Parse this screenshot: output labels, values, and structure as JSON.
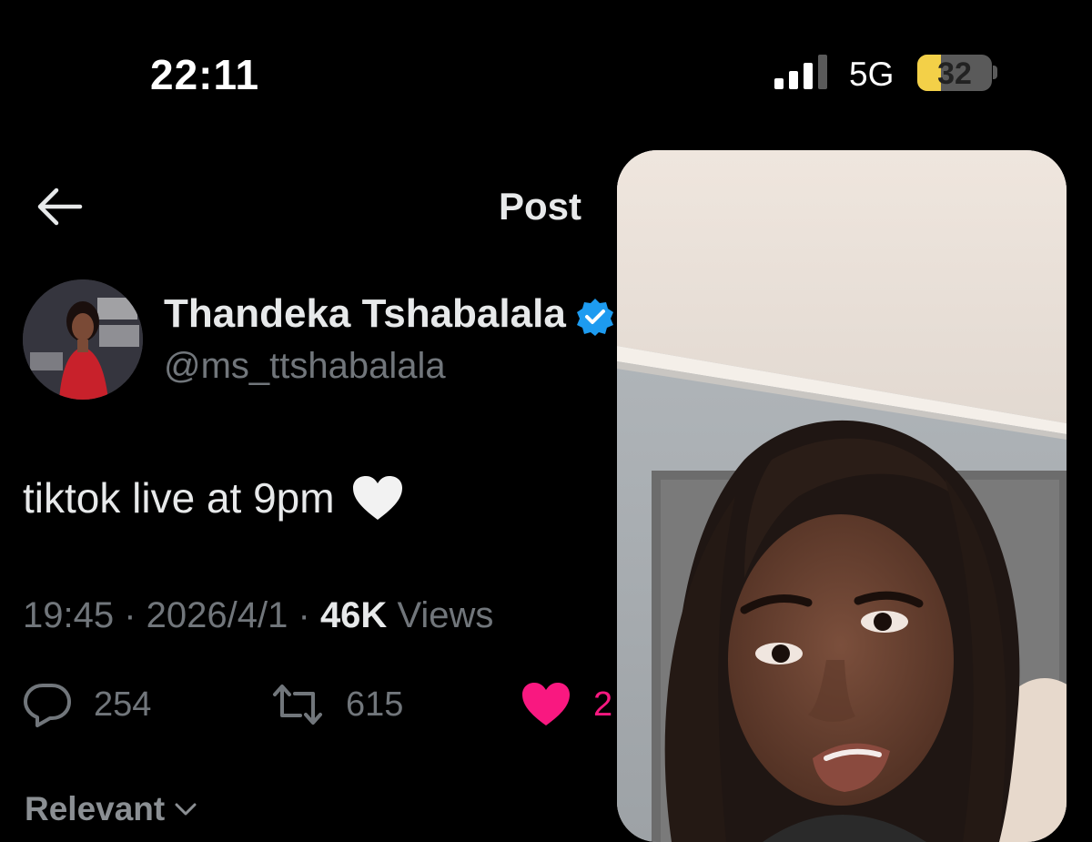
{
  "status_bar": {
    "time": "22:11",
    "network": "5G",
    "battery": "32",
    "battery_level": 0.32,
    "icons": [
      "signal-icon",
      "battery-charging-icon"
    ]
  },
  "header": {
    "title": "Post",
    "back_icon": "back-arrow-icon"
  },
  "post": {
    "author": {
      "name": "Thandeka Tshabalala",
      "handle": "@ms_ttshabalala",
      "verified": true
    },
    "text": "tiktok live at 9pm",
    "emoji": "white-heart-icon",
    "time": "19:45",
    "date": "2026/4/1",
    "views_count": "46K",
    "views_label": "Views",
    "replies": "254",
    "reposts": "615",
    "likes": "2"
  },
  "replies_sort": {
    "label": "Relevant"
  },
  "colors": {
    "background": "#000000",
    "text": "#e7e9ea",
    "muted": "#71767b",
    "like": "#f91880",
    "verified": "#1d9bf0",
    "battery": "#f3d048"
  }
}
